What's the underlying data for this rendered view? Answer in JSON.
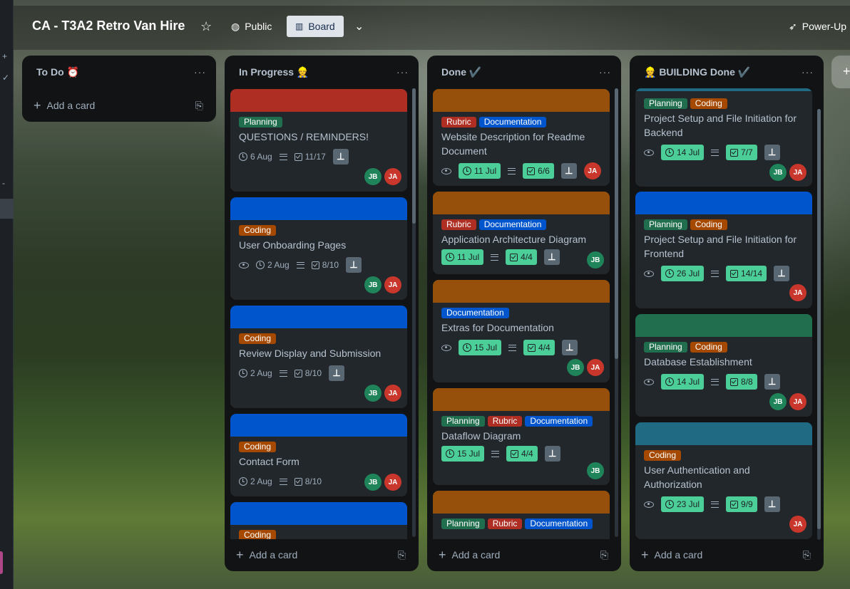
{
  "board": {
    "title": "CA - T3A2 Retro Van Hire",
    "visibility": "Public",
    "view": "Board",
    "power_ups": "Power-Up"
  },
  "colors": {
    "red": "#ae2e24",
    "blue": "#0055cc",
    "orange": "#974f0c",
    "green": "#216e4e",
    "teal": "#206a83",
    "label_planning": "#216e4e",
    "label_coding": "#a54800",
    "label_rubric": "#ae2e24",
    "label_documentation": "#0055cc",
    "date_badge": "#4bce97"
  },
  "lists": [
    {
      "title": "To Do ⏰",
      "add": "Add a card"
    },
    {
      "title": "In Progress 👷",
      "add": "Add a card"
    },
    {
      "title": "Done ✔️",
      "add": "Add a card"
    },
    {
      "title": "👷 BUILDING Done ✔️",
      "add": "Add a card"
    }
  ],
  "inprogress": [
    {
      "labels": [
        "Planning"
      ],
      "title": "QUESTIONS / REMINDERS!",
      "date": "6 Aug",
      "checks": "11/17"
    },
    {
      "labels": [
        "Coding"
      ],
      "title": "User Onboarding Pages",
      "date": "2 Aug",
      "checks": "8/10"
    },
    {
      "labels": [
        "Coding"
      ],
      "title": "Review Display and Submission",
      "date": "2 Aug",
      "checks": "8/10"
    },
    {
      "labels": [
        "Coding"
      ],
      "title": "Contact Form",
      "date": "2 Aug",
      "checks": "8/10"
    },
    {
      "labels": [
        "Coding"
      ]
    }
  ],
  "done": [
    {
      "labels": [
        "Rubric",
        "Documentation"
      ],
      "title": "Website Description for Readme Document",
      "date": "11 Jul",
      "checks": "6/6"
    },
    {
      "labels": [
        "Rubric",
        "Documentation"
      ],
      "title": "Application Architecture Diagram",
      "date": "11 Jul",
      "checks": "4/4"
    },
    {
      "labels": [
        "Documentation"
      ],
      "title": "Extras for Documentation",
      "date": "15 Jul",
      "checks": "4/4"
    },
    {
      "labels": [
        "Planning",
        "Rubric",
        "Documentation"
      ],
      "title": "Dataflow Diagram",
      "date": "15 Jul",
      "checks": "4/4"
    },
    {
      "labels": [
        "Planning",
        "Rubric",
        "Documentation"
      ]
    }
  ],
  "building": [
    {
      "labels": [
        "Planning",
        "Coding"
      ],
      "title": "Project Setup and File Initiation for Backend",
      "date": "14 Jul",
      "checks": "7/7"
    },
    {
      "labels": [
        "Planning",
        "Coding"
      ],
      "title": "Project Setup and File Initiation for Frontend",
      "date": "26 Jul",
      "checks": "14/14"
    },
    {
      "labels": [
        "Planning",
        "Coding"
      ],
      "title": "Database Establishment",
      "date": "14 Jul",
      "checks": "8/8"
    },
    {
      "labels": [
        "Coding"
      ],
      "title": "User Authentication and Authorization",
      "date": "23 Jul",
      "checks": "9/9"
    }
  ],
  "members": {
    "jb": "JB",
    "ja": "JA"
  }
}
